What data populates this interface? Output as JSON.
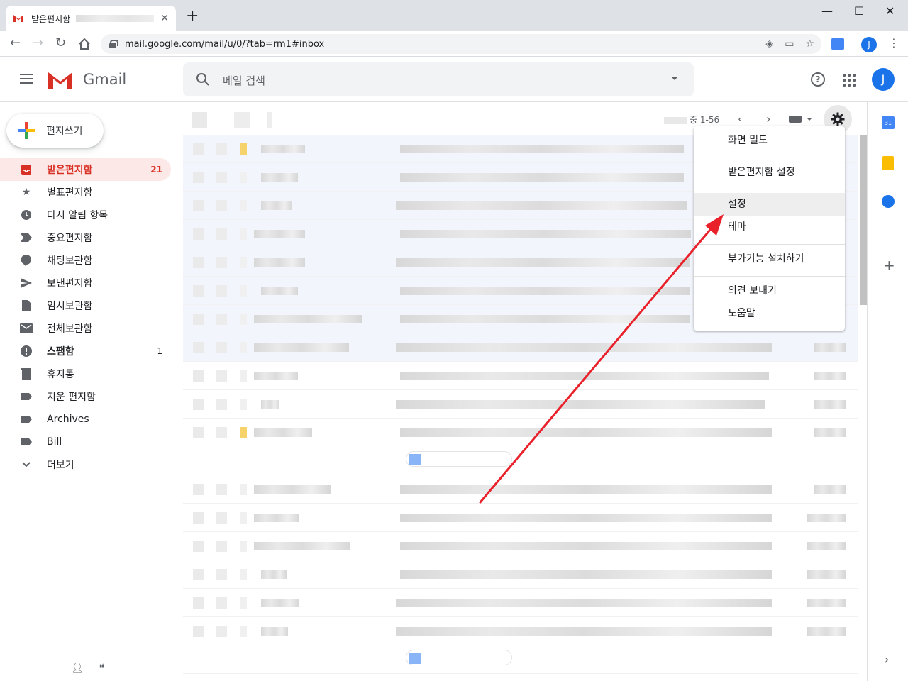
{
  "browser": {
    "tab_title": "받은편지함",
    "url": "mail.google.com/mail/u/0/?tab=rm1#inbox",
    "profile_initial": "J"
  },
  "header": {
    "brand": "Gmail",
    "search_placeholder": "메일 검색",
    "avatar_initial": "J"
  },
  "sidebar": {
    "compose_label": "편지쓰기",
    "items": [
      {
        "label": "받은편지함",
        "count": "21",
        "icon": "inbox-icon"
      },
      {
        "label": "별표편지함",
        "count": "",
        "icon": "star-icon"
      },
      {
        "label": "다시 알림 항목",
        "count": "",
        "icon": "clock-icon"
      },
      {
        "label": "중요편지함",
        "count": "",
        "icon": "important-icon"
      },
      {
        "label": "채팅보관함",
        "count": "",
        "icon": "chat-icon"
      },
      {
        "label": "보낸편지함",
        "count": "",
        "icon": "send-icon"
      },
      {
        "label": "임시보관함",
        "count": "",
        "icon": "draft-icon"
      },
      {
        "label": "전체보관함",
        "count": "",
        "icon": "mail-icon"
      },
      {
        "label": "스팸함",
        "count": "1",
        "icon": "spam-icon"
      },
      {
        "label": "휴지통",
        "count": "",
        "icon": "trash-icon"
      },
      {
        "label": "지운 편지함",
        "count": "",
        "icon": "label-icon"
      },
      {
        "label": "Archives",
        "count": "",
        "icon": "label-icon"
      },
      {
        "label": "Bill",
        "count": "",
        "icon": "label-icon"
      },
      {
        "label": "더보기",
        "count": "",
        "icon": "chevron-down-icon"
      }
    ]
  },
  "toolbar": {
    "page_range": "중 1-56"
  },
  "settings_menu": {
    "items": [
      {
        "label": "화면 밀도"
      },
      {
        "label": "받은편지함 설정"
      },
      {
        "label": "설정"
      },
      {
        "label": "테마"
      },
      {
        "label": "부가기능 설치하기"
      },
      {
        "label": "의견 보내기"
      },
      {
        "label": "도움말"
      }
    ]
  },
  "side_panel": {
    "calendar_date": "31"
  },
  "colors": {
    "accent": "#d93025",
    "active_bg": "#fce8e6",
    "annotation_arrow": "#e8212b"
  }
}
